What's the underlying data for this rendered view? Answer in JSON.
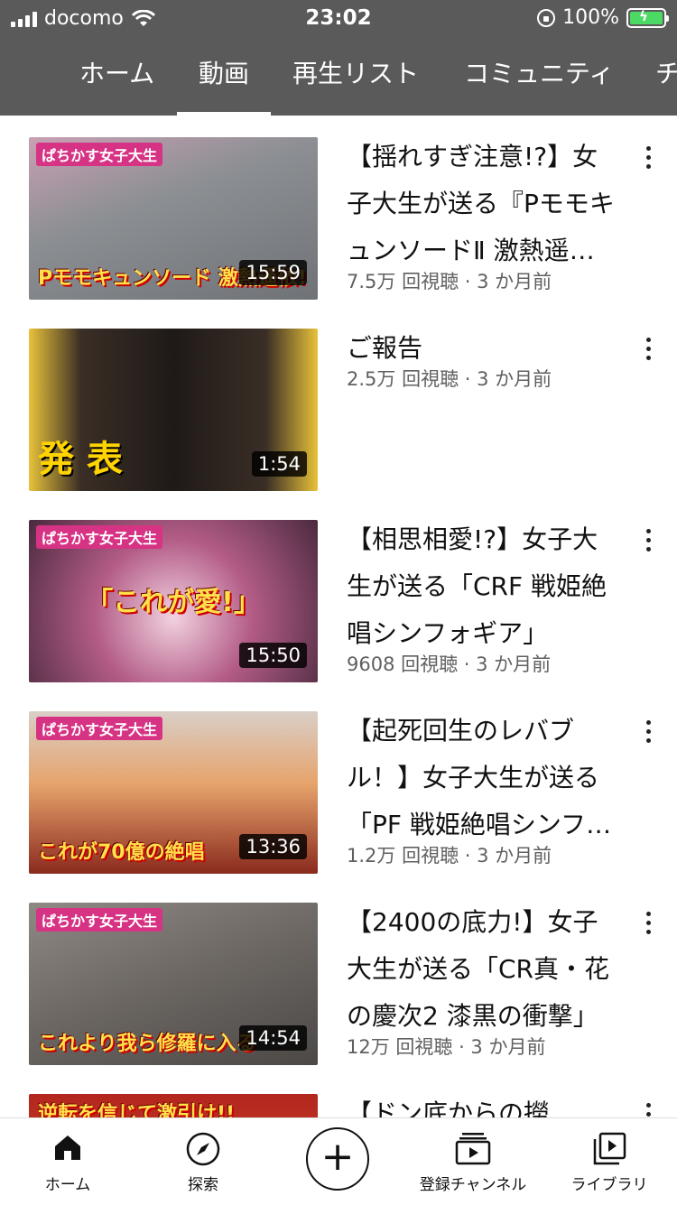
{
  "status": {
    "carrier": "docomo",
    "time": "23:02",
    "battery": "100%"
  },
  "tabs": [
    {
      "label": "ホーム",
      "active": false
    },
    {
      "label": "動画",
      "active": true
    },
    {
      "label": "再生リスト",
      "active": false
    },
    {
      "label": "コミュニティ",
      "active": false
    },
    {
      "label": "チ",
      "active": false
    }
  ],
  "videos": [
    {
      "title": "【揺れすぎ注意!?】女子大生が送る『PモモキュンソードⅡ 激熱遥依!!!』",
      "meta": "7.5万 回視聴 · 3 か月前",
      "duration": "15:59",
      "thumb_tag": "ぱちかす女子大生",
      "thumb_caption": "Pモモキュンソード 激熱遥依!!!",
      "thumb_color": "#9aa0a6"
    },
    {
      "title": "ご報告",
      "meta": "2.5万 回視聴 · 3 か月前",
      "duration": "1:54",
      "thumb_tag": "",
      "thumb_caption": "発 表",
      "thumb_color": "#5a4a3c"
    },
    {
      "title": "【相思相愛!?】女子大生が送る「CRF 戦姫絶唱シンフォギア」",
      "meta": "9608 回視聴 · 3 か月前",
      "duration": "15:50",
      "thumb_tag": "ぱちかす女子大生",
      "thumb_caption": "「これが愛!」",
      "thumb_color": "#7a4a66"
    },
    {
      "title": "【起死回生のレバブル！】女子大生が送る「PF 戦姫絶唱シンフォギア」",
      "meta": "1.2万 回視聴 · 3 か月前",
      "duration": "13:36",
      "thumb_tag": "ぱちかす女子大生",
      "thumb_caption": "これが70億の絶唱",
      "thumb_color": "#a2826a"
    },
    {
      "title": "【2400の底力!】女子大生が送る「CR真・花の慶次2 漆黒の衝撃」",
      "meta": "12万 回視聴 · 3 か月前",
      "duration": "14:54",
      "thumb_tag": "ぱちかす女子大生",
      "thumb_caption": "これより我ら修羅に入る",
      "thumb_color": "#6f6a66"
    },
    {
      "title": "【ドン底からの撈",
      "meta": "",
      "duration": "",
      "thumb_tag": "",
      "thumb_caption": "逆転を信じて激引け!!",
      "thumb_color": "#c0392b"
    }
  ],
  "bottom_nav": [
    {
      "label": "ホーム",
      "icon": "home-icon"
    },
    {
      "label": "探索",
      "icon": "compass-icon"
    },
    {
      "label": "",
      "icon": "add-icon"
    },
    {
      "label": "登録チャンネル",
      "icon": "subscriptions-icon"
    },
    {
      "label": "ライブラリ",
      "icon": "library-icon"
    }
  ],
  "colors": {
    "header_bg": "#5a5a5a",
    "battery_green": "#4cd964",
    "meta_gray": "#606060"
  }
}
